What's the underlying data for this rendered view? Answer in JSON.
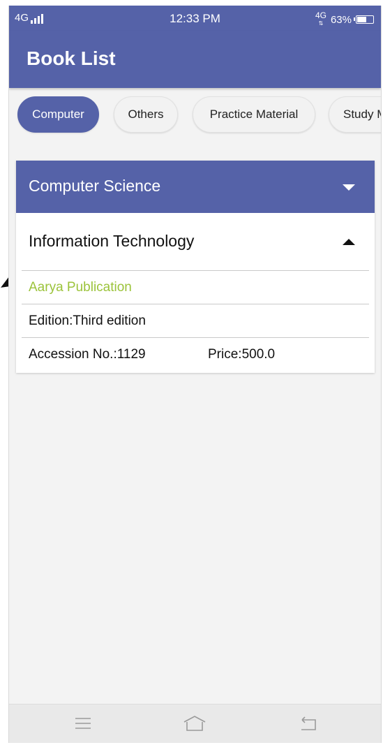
{
  "status_bar": {
    "network_left": "4G",
    "time": "12:33 PM",
    "network_right": "4G",
    "battery": "63%",
    "battery_level": 0.63
  },
  "app_bar": {
    "title": "Book List"
  },
  "categories": [
    {
      "label": "Computer",
      "active": true
    },
    {
      "label": "Others",
      "active": false
    },
    {
      "label": "Practice Material",
      "active": false
    },
    {
      "label": "Study M",
      "active": false
    }
  ],
  "group": {
    "title": "Computer Science",
    "subgroup_title": "Information Technology",
    "publisher": "Aarya Publication",
    "edition": "Edition:Third edition",
    "accession": "Accession No.:1129",
    "price": "Price:500.0"
  },
  "icons": {
    "menu": "menu-icon",
    "home": "home-icon",
    "back": "back-icon",
    "expand": "chevron-down-icon",
    "collapse": "chevron-up-icon"
  },
  "colors": {
    "primary": "#5562a8",
    "publisher_text": "#9bc33a",
    "background": "#f3f3f3"
  }
}
